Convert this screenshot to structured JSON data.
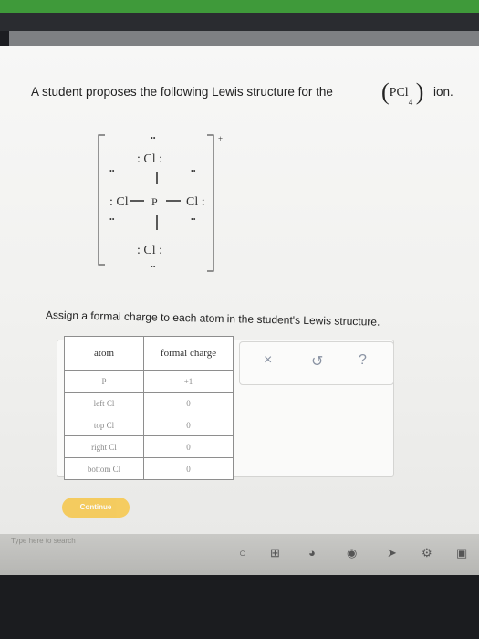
{
  "question": {
    "text": "A student proposes the following Lewis structure for the",
    "ion_formula": "PCl",
    "ion_subscript": "4",
    "ion_charge": "+",
    "ion_word": "ion."
  },
  "lewis": {
    "top_atom": ": Cl :",
    "left_atom": ": Cl",
    "center_atom": "P",
    "right_atom": "Cl :",
    "bottom_atom": ": Cl :",
    "dots": "••",
    "charge": "+"
  },
  "instruction": "Assign a formal charge to each atom in the student's Lewis structure.",
  "table": {
    "headers": [
      "atom",
      "formal charge"
    ],
    "rows": [
      {
        "atom": "P",
        "charge": "+1"
      },
      {
        "atom": "left Cl",
        "charge": "0"
      },
      {
        "atom": "top Cl",
        "charge": "0"
      },
      {
        "atom": "right Cl",
        "charge": "0"
      },
      {
        "atom": "bottom Cl",
        "charge": "0"
      }
    ]
  },
  "actions": {
    "clear": "×",
    "undo": "↺",
    "help": "?"
  },
  "continue_label": "Continue",
  "taskbar": {
    "search_placeholder": "Type here to search"
  },
  "colors": {
    "accent": "#f7c43d",
    "green_bar": "#3f9a3a"
  }
}
